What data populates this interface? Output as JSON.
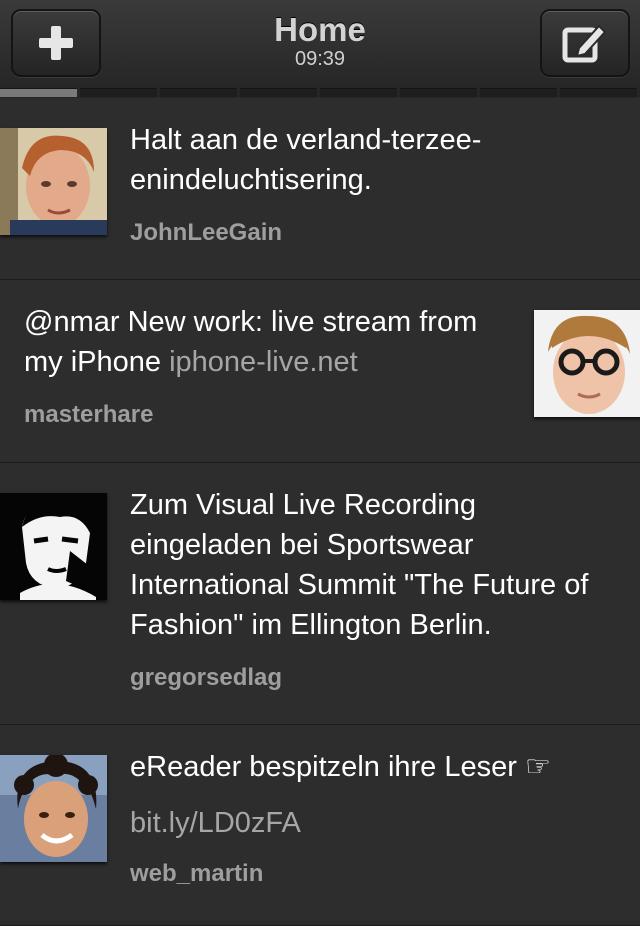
{
  "header": {
    "title": "Home",
    "time": "09:39",
    "compose_icon": "compose-icon",
    "add_icon": "plus-icon",
    "tabs_count": 8,
    "active_tab": 0
  },
  "tweets": [
    {
      "text": "Halt aan de verland-terzee-enindeluchtisering.",
      "link": "",
      "author": "JohnLeeGain",
      "avatar_side": "left"
    },
    {
      "text": "@nmar New work: live stream from my iPhone",
      "link": "iphone-live.net",
      "author": "masterhare",
      "avatar_side": "right"
    },
    {
      "text": "Zum Visual Live Recording eingeladen bei Sportswear International Summit \"The Future of Fashion\" im Ellington Berlin.",
      "link": "",
      "author": "gregorsedlag",
      "avatar_side": "left"
    },
    {
      "text": "eReader bespitzeln ihre Leser ☞",
      "link": "bit.ly/LD0zFA",
      "author": "web_martin",
      "avatar_side": "left"
    }
  ],
  "colors": {
    "background": "#2d2d2d",
    "navbar": "#2a2a2a",
    "text": "#ffffff",
    "author": "#9e9e9e",
    "link": "#a6a6a6"
  }
}
